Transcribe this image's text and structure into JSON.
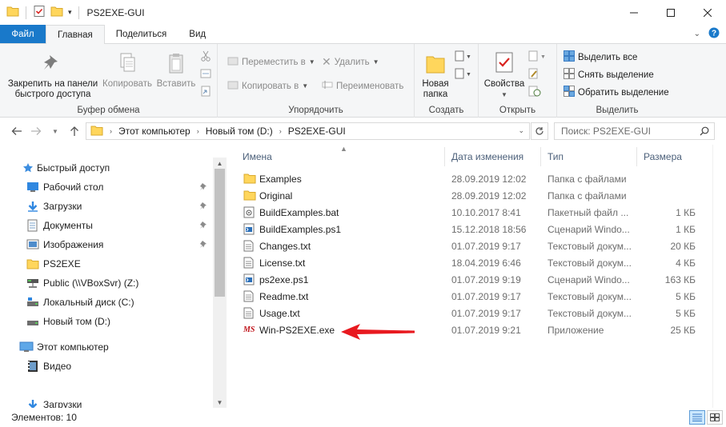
{
  "window": {
    "title": "PS2EXE-GUI"
  },
  "ribbon_tabs": [
    {
      "label": "Файл"
    },
    {
      "label": "Главная"
    },
    {
      "label": "Поделиться"
    },
    {
      "label": "Вид"
    }
  ],
  "clipboard": {
    "pin_label": "Закрепить на панели быстрого доступа",
    "pin_line1": "Закрепить на панели",
    "pin_line2": "быстрого доступа",
    "copy_label": "Копировать",
    "paste_label": "Вставить",
    "group_label": "Буфер обмена"
  },
  "organize": {
    "move_label": "Переместить в",
    "copy_to_label": "Копировать в",
    "delete_label": "Удалить",
    "rename_label": "Переименовать",
    "group_label": "Упорядочить"
  },
  "create": {
    "new_folder_line1": "Новая",
    "new_folder_line2": "папка",
    "group_label": "Создать"
  },
  "open": {
    "properties_label": "Свойства",
    "group_label": "Открыть"
  },
  "select": {
    "select_all": "Выделить все",
    "select_none": "Снять выделение",
    "invert": "Обратить выделение",
    "group_label": "Выделить"
  },
  "address": {
    "crumbs": [
      "Этот компьютер",
      "Новый том (D:)",
      "PS2EXE-GUI"
    ]
  },
  "search": {
    "placeholder": "Поиск: PS2EXE-GUI"
  },
  "nav": {
    "quick_access": "Быстрый доступ",
    "desktop": "Рабочий стол",
    "downloads": "Загрузки",
    "documents": "Документы",
    "pictures": "Изображения",
    "ps2exe": "PS2EXE",
    "public": "Public (\\\\VBoxSvr) (Z:)",
    "local_c": "Локальный диск (C:)",
    "new_d": "Новый том (D:)",
    "this_pc": "Этот компьютер",
    "video": "Видео",
    "downloads2": "Загрузки"
  },
  "columns": {
    "name": "Имена",
    "date": "Дата изменения",
    "type": "Тип",
    "size": "Размера"
  },
  "files": [
    {
      "name": "Examples",
      "date": "28.09.2019 12:02",
      "type": "Папка с файлами",
      "size": "",
      "icon": "folder-icon"
    },
    {
      "name": "Original",
      "date": "28.09.2019 12:02",
      "type": "Папка с файлами",
      "size": "",
      "icon": "folder-icon"
    },
    {
      "name": "BuildExamples.bat",
      "date": "10.10.2017 8:41",
      "type": "Пакетный файл ...",
      "size": "1 КБ",
      "icon": "batch-file-icon"
    },
    {
      "name": "BuildExamples.ps1",
      "date": "15.12.2018 18:56",
      "type": "Сценарий Windo...",
      "size": "1 КБ",
      "icon": "powershell-script-icon"
    },
    {
      "name": "Changes.txt",
      "date": "01.07.2019 9:17",
      "type": "Текстовый докум...",
      "size": "20 КБ",
      "icon": "text-file-icon"
    },
    {
      "name": "License.txt",
      "date": "18.04.2019 6:46",
      "type": "Текстовый докум...",
      "size": "4 КБ",
      "icon": "text-file-icon"
    },
    {
      "name": "ps2exe.ps1",
      "date": "01.07.2019 9:19",
      "type": "Сценарий Windo...",
      "size": "163 КБ",
      "icon": "powershell-script-icon"
    },
    {
      "name": "Readme.txt",
      "date": "01.07.2019 9:17",
      "type": "Текстовый докум...",
      "size": "5 КБ",
      "icon": "text-file-icon"
    },
    {
      "name": "Usage.txt",
      "date": "01.07.2019 9:17",
      "type": "Текстовый докум...",
      "size": "5 КБ",
      "icon": "text-file-icon"
    },
    {
      "name": "Win-PS2EXE.exe",
      "date": "01.07.2019 9:21",
      "type": "Приложение",
      "size": "25 КБ",
      "icon": "exe-app-icon",
      "icon_text": "MS"
    }
  ],
  "status": {
    "items_count": "Элементов: 10"
  },
  "colors": {
    "file_tab": "#1979ca",
    "folder": "#ffd65c",
    "annotation_arrow": "#e8191f",
    "exe_icon": "#c0161d"
  }
}
